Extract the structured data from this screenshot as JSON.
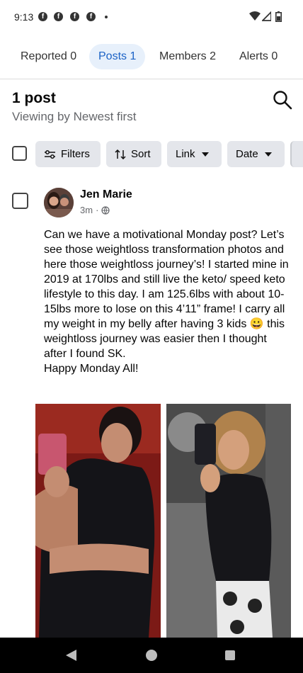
{
  "status_bar": {
    "time": "9:13",
    "notification_icons": [
      "facebook-icon",
      "facebook-icon",
      "facebook-icon",
      "facebook-icon"
    ],
    "system_icons": [
      "wifi-icon",
      "cell-signal-icon",
      "battery-icon"
    ]
  },
  "tabs": [
    {
      "label": "Reported 0",
      "active": false
    },
    {
      "label": "Posts 1",
      "active": true
    },
    {
      "label": "Members 2",
      "active": false
    },
    {
      "label": "Alerts 0",
      "active": false
    }
  ],
  "header": {
    "post_count": "1 post",
    "sort_caption": "Viewing by Newest first"
  },
  "filters": {
    "filters_label": "Filters",
    "sort_label": "Sort",
    "link_label": "Link",
    "date_label": "Date"
  },
  "post": {
    "author": "Jen Marie",
    "time": "3m",
    "separator": "·",
    "privacy_icon": "globe-icon",
    "body_lines": [
      "Can we have a motivational Monday post? Let’s see those weightloss transformation photos and here those weightloss journey’s! I started mine in 2019 at 170lbs and still live the keto/ speed keto lifestyle to this day. I am 125.6lbs with about 10-15lbs more to lose on this 4’11” frame! I carry all my weight in my belly after having 3 kids 😀 this weightloss journey was easier then I thought after I found SK.",
      "Happy Monday All!"
    ]
  },
  "nav_bar": {
    "icons": [
      "back-icon",
      "home-icon",
      "recents-icon"
    ]
  },
  "colors": {
    "accent": "#1b62c6",
    "active_tab_bg": "#e7f0fb",
    "chip_bg": "#e4e6eb",
    "secondary_text": "#65676b"
  }
}
